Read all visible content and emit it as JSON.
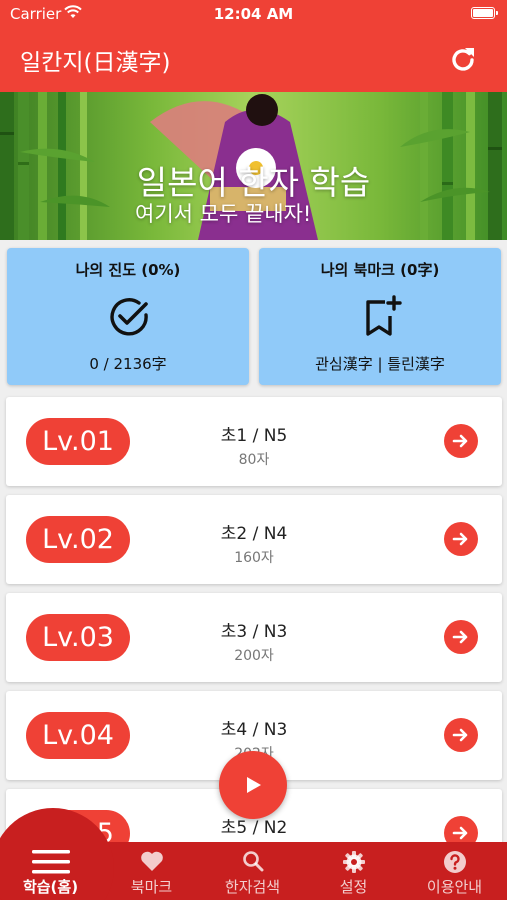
{
  "status_bar": {
    "carrier": "Carrier",
    "time": "12:04 AM"
  },
  "nav": {
    "title": "일칸지(日漢字)",
    "refresh_icon": "refresh-icon"
  },
  "banner": {
    "title": "일본어 한자 학습",
    "subtitle": "여기서 모두 끝내자!"
  },
  "cards": {
    "progress": {
      "title": "나의 진도 (0%)",
      "icon": "check-circle-icon",
      "value": "0 / 2136字",
      "percent": 0
    },
    "bookmark": {
      "title": "나의 북마크 (0字)",
      "icon": "bookmark-add-icon",
      "value": "관심漢字 | 틀린漢字"
    }
  },
  "levels": [
    {
      "badge": "Lv.01",
      "name": "초1 / N5",
      "count": "80자"
    },
    {
      "badge": "Lv.02",
      "name": "초2 / N4",
      "count": "160자"
    },
    {
      "badge": "Lv.03",
      "name": "초3 / N3",
      "count": "200자"
    },
    {
      "badge": "Lv.04",
      "name": "초4 / N3",
      "count": "202자"
    },
    {
      "badge": "Lv.05",
      "name": "초5 / N2",
      "count": ""
    }
  ],
  "fab": {
    "icon": "play-icon"
  },
  "tabs": [
    {
      "label": "학습(홈)",
      "icon": "menu-icon",
      "active": true
    },
    {
      "label": "북마크",
      "icon": "heart-icon"
    },
    {
      "label": "한자검색",
      "icon": "search-icon"
    },
    {
      "label": "설정",
      "icon": "gear-icon"
    },
    {
      "label": "이용안내",
      "icon": "help-icon"
    }
  ],
  "colors": {
    "primary": "#ef4136",
    "tab_bar": "#c81f1f",
    "card": "#90caf9",
    "background": "#efefef"
  }
}
